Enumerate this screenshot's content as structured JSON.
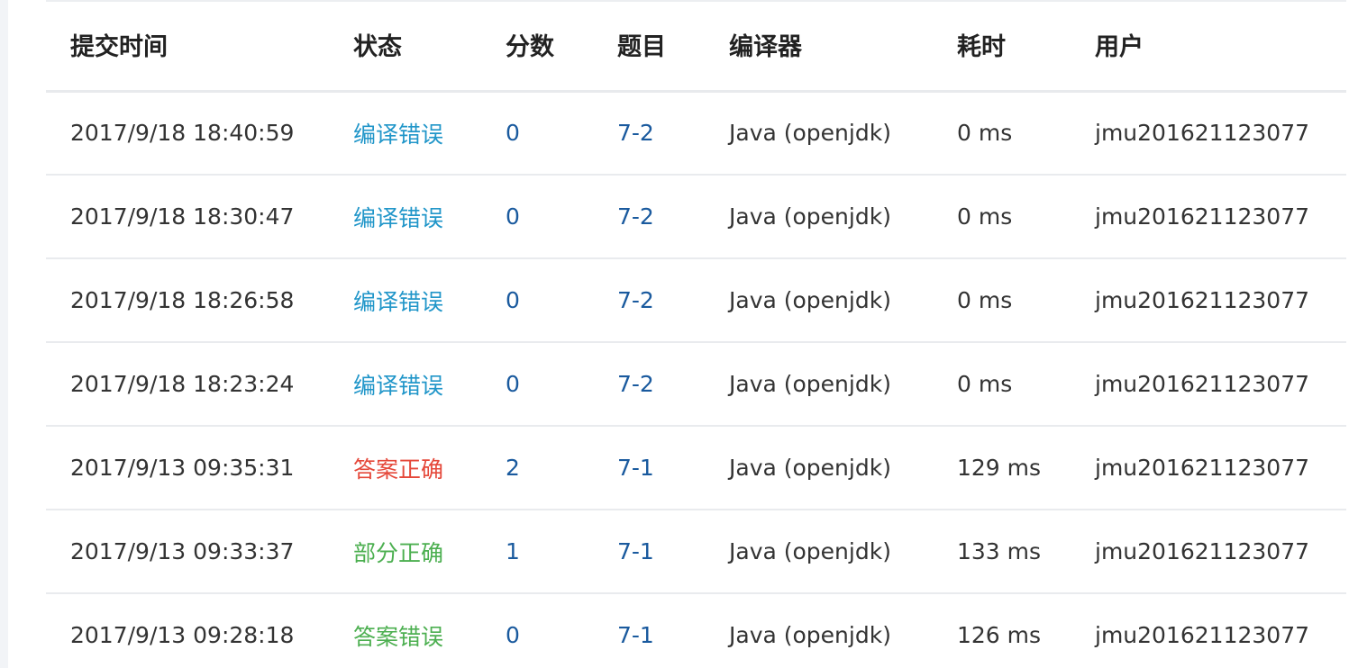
{
  "table": {
    "headers": [
      "提交时间",
      "状态",
      "分数",
      "题目",
      "编译器",
      "耗时",
      "用户"
    ],
    "rows": [
      {
        "time": "2017/9/18 18:40:59",
        "status": "编译错误",
        "status_color": "#2196c9",
        "score": "0",
        "problem": "7-2",
        "compiler": "Java (openjdk)",
        "elapsed": "0 ms",
        "user": "jmu201621123077"
      },
      {
        "time": "2017/9/18 18:30:47",
        "status": "编译错误",
        "status_color": "#2196c9",
        "score": "0",
        "problem": "7-2",
        "compiler": "Java (openjdk)",
        "elapsed": "0 ms",
        "user": "jmu201621123077"
      },
      {
        "time": "2017/9/18 18:26:58",
        "status": "编译错误",
        "status_color": "#2196c9",
        "score": "0",
        "problem": "7-2",
        "compiler": "Java (openjdk)",
        "elapsed": "0 ms",
        "user": "jmu201621123077"
      },
      {
        "time": "2017/9/18 18:23:24",
        "status": "编译错误",
        "status_color": "#2196c9",
        "score": "0",
        "problem": "7-2",
        "compiler": "Java (openjdk)",
        "elapsed": "0 ms",
        "user": "jmu201621123077"
      },
      {
        "time": "2017/9/13 09:35:31",
        "status": "答案正确",
        "status_color": "#e5483a",
        "score": "2",
        "problem": "7-1",
        "compiler": "Java (openjdk)",
        "elapsed": "129 ms",
        "user": "jmu201621123077"
      },
      {
        "time": "2017/9/13 09:33:37",
        "status": "部分正确",
        "status_color": "#4caf50",
        "score": "1",
        "problem": "7-1",
        "compiler": "Java (openjdk)",
        "elapsed": "133 ms",
        "user": "jmu201621123077"
      },
      {
        "time": "2017/9/13 09:28:18",
        "status": "答案错误",
        "status_color": "#4caf50",
        "score": "0",
        "problem": "7-1",
        "compiler": "Java (openjdk)",
        "elapsed": "126 ms",
        "user": "jmu201621123077"
      }
    ]
  }
}
